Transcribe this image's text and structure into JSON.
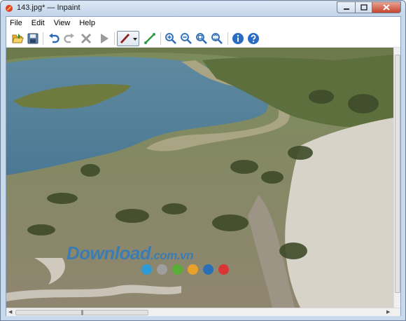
{
  "window": {
    "title": "143.jpg* — Inpaint",
    "controls": {
      "minimize": "minimize",
      "maximize": "maximize",
      "close": "close"
    }
  },
  "menu": {
    "items": [
      "File",
      "Edit",
      "View",
      "Help"
    ]
  },
  "toolbar": {
    "buttons": [
      {
        "name": "open-icon"
      },
      {
        "name": "save-icon"
      },
      {
        "name": "undo-icon"
      },
      {
        "name": "redo-icon"
      },
      {
        "name": "clear-icon"
      },
      {
        "name": "run-icon"
      },
      {
        "name": "marker-icon"
      },
      {
        "name": "line-icon"
      },
      {
        "name": "zoom-in-icon"
      },
      {
        "name": "zoom-out-icon"
      },
      {
        "name": "zoom-fit-icon"
      },
      {
        "name": "zoom-actual-icon"
      },
      {
        "name": "info-icon"
      },
      {
        "name": "help-icon"
      }
    ]
  },
  "watermark": {
    "main": "Download",
    "domain": ".com.vn",
    "dot_colors": [
      "#2e9ad6",
      "#9e9e9e",
      "#5aad36",
      "#e8a22a",
      "#2a6fb5",
      "#d93535"
    ]
  },
  "scrollbar_h": {
    "grip": "|||"
  },
  "colors": {
    "accent": "#2f7bbd",
    "titlebar": "#c9d9ec"
  }
}
